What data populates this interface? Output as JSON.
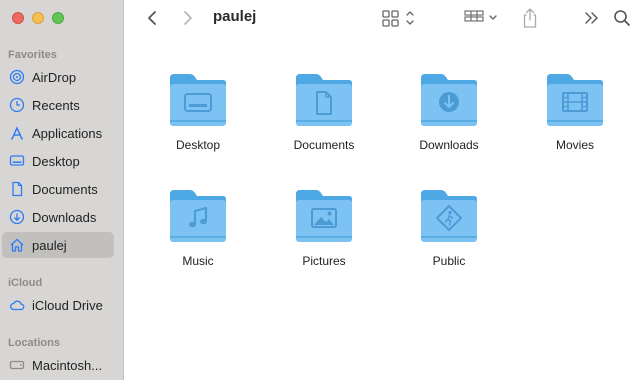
{
  "window": {
    "title": "paulej"
  },
  "sidebar": {
    "sections": [
      {
        "title": "Favorites"
      },
      {
        "title": "iCloud"
      },
      {
        "title": "Locations"
      }
    ],
    "favorites": [
      {
        "label": "AirDrop",
        "icon": "airdrop-icon"
      },
      {
        "label": "Recents",
        "icon": "clock-icon"
      },
      {
        "label": "Applications",
        "icon": "applications-icon"
      },
      {
        "label": "Desktop",
        "icon": "desktop-icon"
      },
      {
        "label": "Documents",
        "icon": "document-icon"
      },
      {
        "label": "Downloads",
        "icon": "download-icon"
      },
      {
        "label": "paulej",
        "icon": "home-icon",
        "selected": true
      }
    ],
    "icloud": [
      {
        "label": "iCloud Drive",
        "icon": "cloud-icon"
      }
    ],
    "locations": [
      {
        "label": "Macintosh...",
        "icon": "disk-icon"
      }
    ]
  },
  "toolbar": {
    "back": "chevron-left-icon",
    "forward": "chevron-right-icon",
    "view": "icon-grid-icon",
    "group": "group-icon",
    "share": "share-icon",
    "more": "chevron-double-right-icon",
    "search": "search-icon"
  },
  "items": [
    {
      "label": "Desktop",
      "glyph": "desktop"
    },
    {
      "label": "Documents",
      "glyph": "document"
    },
    {
      "label": "Downloads",
      "glyph": "download"
    },
    {
      "label": "Movies",
      "glyph": "film"
    },
    {
      "label": "Music",
      "glyph": "music"
    },
    {
      "label": "Pictures",
      "glyph": "picture"
    },
    {
      "label": "Public",
      "glyph": "public"
    }
  ],
  "colors": {
    "folder_back": "#5aaee6",
    "folder_front": "#7cc3f3",
    "sidebar_bg": "#d7d6d4",
    "accent": "#2f7bf5"
  }
}
